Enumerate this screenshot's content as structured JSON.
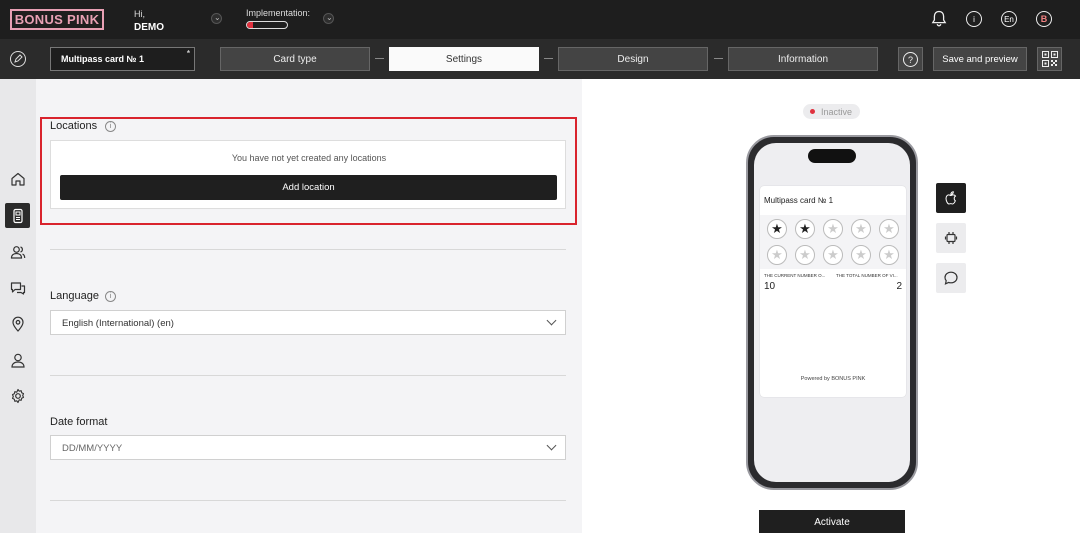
{
  "brand": {
    "logo": "BONUS PINK",
    "pink": "#e8a0b4"
  },
  "header": {
    "greeting": "Hi,",
    "user": "DEMO",
    "implementation_label": "Implementation:",
    "implementation_progress": 0.15,
    "language_code": "En",
    "avatar_letter": "B"
  },
  "toolbar": {
    "card_name": "Multipass card № 1",
    "steps": [
      "Card type",
      "Settings",
      "Design",
      "Information"
    ],
    "active_step": "Settings",
    "save_label": "Save and preview"
  },
  "settings": {
    "locations": {
      "title": "Locations",
      "empty_text": "You have not yet created any locations",
      "add_label": "Add location"
    },
    "language": {
      "title": "Language",
      "value": "English (International) (en)"
    },
    "date_format": {
      "title": "Date format",
      "placeholder": "DD/MM/YYYY"
    }
  },
  "preview": {
    "status": "Inactive",
    "pass_title": "Multipass card № 1",
    "stamps_total": 10,
    "stamps_filled": 2,
    "field1_label": "THE CURRENT NUMBER O...",
    "field1_value": "10",
    "field2_label": "THE TOTAL NUMBER OF VI...",
    "field2_value": "2",
    "powered_by": "Powered by BONUS PINK",
    "activate_label": "Activate"
  },
  "colors": {
    "accent_red": "#e0313e",
    "dark": "#1e1e1e",
    "highlight": "#d9232d"
  },
  "icons": [
    "bell-icon",
    "info-icon",
    "home-icon",
    "card-icon",
    "users-icon",
    "chat-icon",
    "location-icon",
    "user-icon",
    "gear-icon",
    "apple-icon",
    "android-icon",
    "message-icon",
    "qr-icon",
    "edit-icon",
    "help-icon"
  ]
}
